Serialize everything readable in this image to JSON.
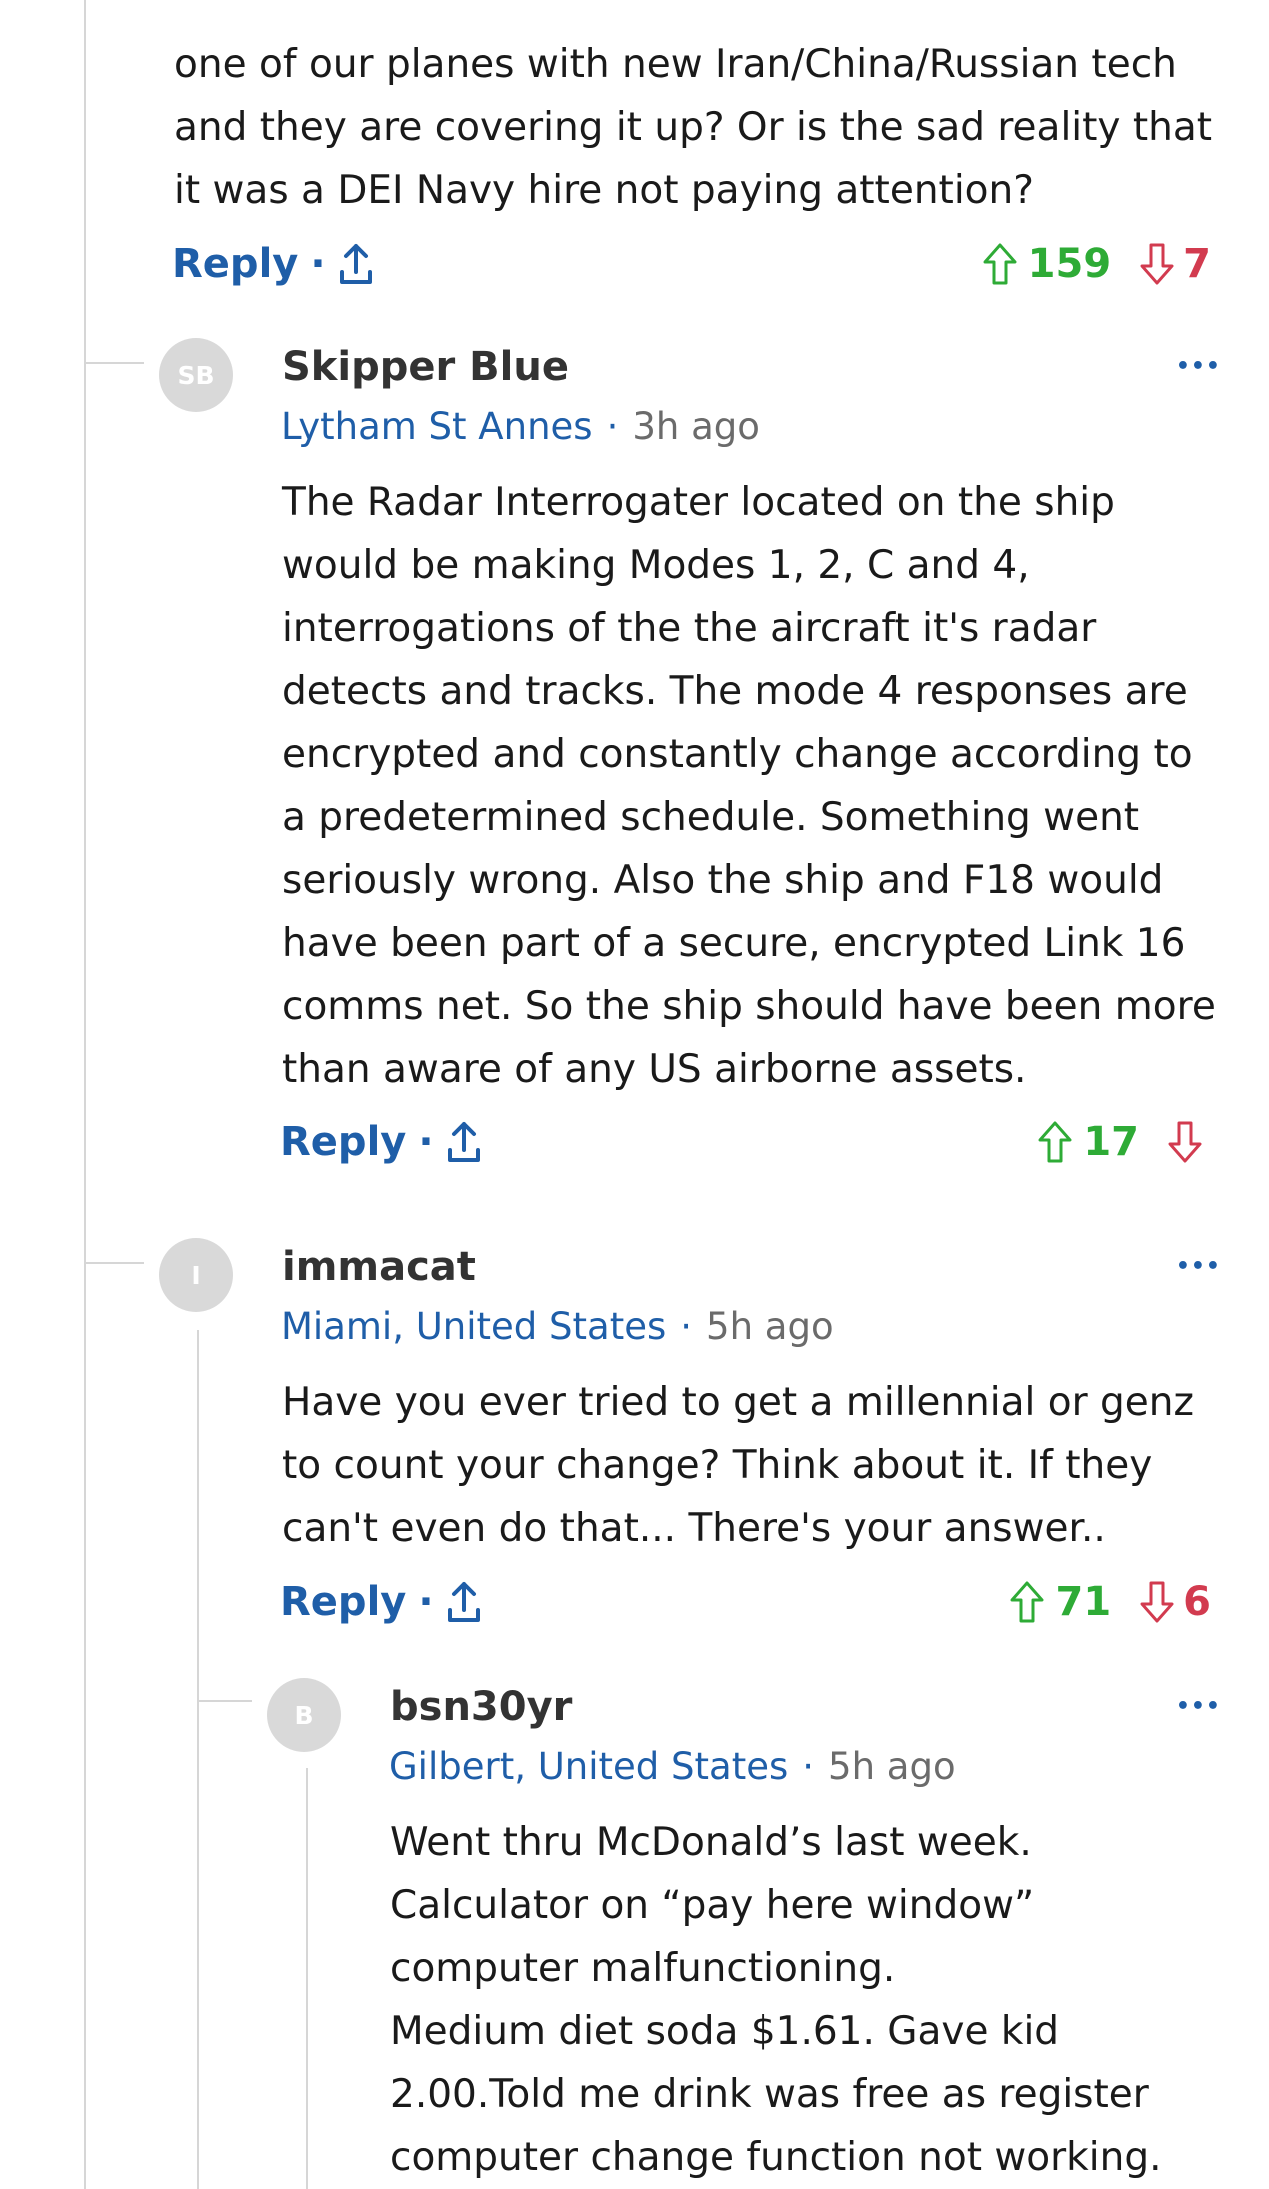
{
  "colors": {
    "link_blue": "#1f5ea8",
    "upvote_green": "#2eab36",
    "downvote_red": "#d23b4f",
    "avatar_gray": "#d9d9d9",
    "thread_line": "#d6d6d6"
  },
  "separator": "·",
  "top_comment": {
    "text_lines": [
      "one of our planes with new Iran/China/Russian tech",
      "and they are covering it up? Or is the sad reality that",
      "it was a DEI Navy hire not paying attention?"
    ],
    "reply_label": "Reply",
    "share_icon": "share-icon",
    "upvotes": "159",
    "downvotes": "7"
  },
  "comments": [
    {
      "avatar_initials": "SB",
      "author": "Skipper Blue",
      "location": "Lytham St Annes",
      "time": "3h ago",
      "more_label": "•••",
      "text_lines": [
        "The Radar Interrogater located on the ship",
        "would be making Modes 1, 2, C and 4,",
        "interrogations of the the aircraft it's radar",
        "detects and tracks. The mode 4 responses are",
        "encrypted and constantly change according to",
        "a predetermined schedule. Something went",
        "seriously wrong. Also the ship and F18 would",
        "have been part of a secure, encrypted Link 16",
        "comms net. So the ship should have been more",
        "than aware of any US airborne assets."
      ],
      "reply_label": "Reply",
      "upvotes": "17",
      "downvotes": ""
    },
    {
      "avatar_initials": "I",
      "author": "immacat",
      "location": "Miami, United States",
      "time": "5h ago",
      "more_label": "•••",
      "text_lines": [
        "Have you ever tried to get a millennial or genz",
        "to count your change? Think about it. If they",
        "can't even do that... There's your answer.."
      ],
      "reply_label": "Reply",
      "upvotes": "71",
      "downvotes": "6"
    },
    {
      "avatar_initials": "B",
      "author": "bsn30yr",
      "location": "Gilbert, United States",
      "time": "5h ago",
      "more_label": "•••",
      "text_lines": [
        "Went thru McDonald’s last week.",
        "Calculator on “pay here window”",
        "computer malfunctioning.",
        "Medium diet soda $1.61. Gave kid",
        "2.00.Told me drink was free as register",
        "computer change function not working."
      ]
    }
  ]
}
